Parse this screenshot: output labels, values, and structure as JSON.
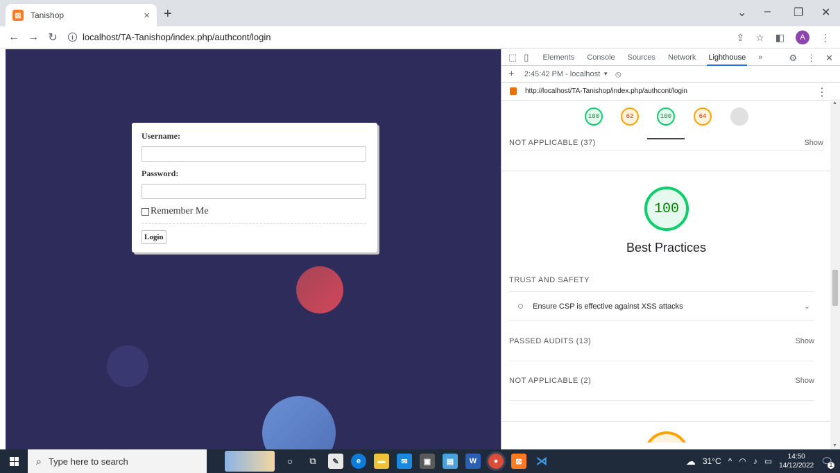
{
  "browser": {
    "tab_title": "Tanishop",
    "tab_icon": "xampp-icon",
    "tab_close": "×",
    "new_tab": "+",
    "window_controls": {
      "minimize": "–",
      "maximize": "❐",
      "close": "✕",
      "dropdown": "⌄"
    },
    "url": "localhost/TA-Tanishop/index.php/authcont/login",
    "profile_initial": "A"
  },
  "login_form": {
    "username_label": "Username:",
    "password_label": "Password:",
    "remember_label": "Remember Me",
    "login_button": "Login"
  },
  "devtools": {
    "tabs": [
      "Elements",
      "Console",
      "Sources",
      "Network",
      "Lighthouse"
    ],
    "active_tab": "Lighthouse",
    "more_tabs": "»",
    "report_time": "2:45:42 PM - localhost",
    "report_url": "http://localhost/TA-Tanishop/index.php/authcont/login",
    "mini_scores": [
      "100",
      "62",
      "100",
      "64",
      ""
    ],
    "not_applicable_top": "NOT APPLICABLE (37)",
    "show": "Show",
    "best_practices_score": "100",
    "best_practices_title": "Best Practices",
    "trust_safety": "TRUST AND SAFETY",
    "csp_audit": "Ensure CSP is effective against XSS attacks",
    "passed_audits": "PASSED AUDITS (13)",
    "not_applicable_bottom": "NOT APPLICABLE (2)"
  },
  "taskbar": {
    "search_placeholder": "Type here to search",
    "weather": "31°C",
    "time": "14:50",
    "date": "14/12/2022",
    "notification_count": "1"
  },
  "colors": {
    "page_background": "#2e2c5a",
    "score_green": "#0cce6b",
    "score_orange": "#ffa400",
    "active_tab_accent": "#1a73e8"
  }
}
